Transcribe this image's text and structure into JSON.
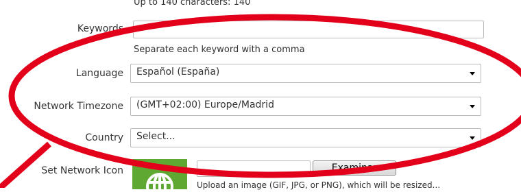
{
  "title_hint": "Up to 140 characters: 140",
  "keywords": {
    "label": "Keywords",
    "value": "",
    "hint": "Separate each keyword with a comma"
  },
  "language": {
    "label": "Language",
    "selected": "Español (España)"
  },
  "timezone": {
    "label": "Network Timezone",
    "selected": "(GMT+02:00) Europe/Madrid"
  },
  "country": {
    "label": "Country",
    "selected": "Select..."
  },
  "network_icon": {
    "label": "Set Network Icon",
    "icon": "globe-icon",
    "file_button": "Examinar",
    "note": "Upload an image (GIF, JPG, or PNG), which will be resized..."
  },
  "colors": {
    "annotation": "#e3001b",
    "icon_bg": "#5fa831"
  }
}
